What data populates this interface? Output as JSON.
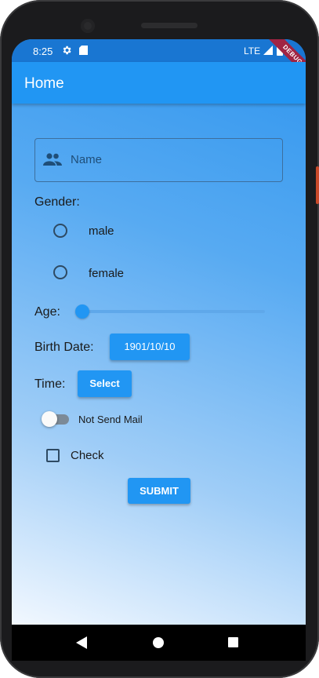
{
  "status_bar": {
    "time": "8:25",
    "network": "LTE",
    "icons": [
      "gear-icon",
      "sd-card-icon",
      "signal-icon",
      "battery-icon"
    ]
  },
  "debug_banner": "DEBUG",
  "app_bar": {
    "title": "Home"
  },
  "form": {
    "name_field": {
      "placeholder": "Name",
      "value": "",
      "icon": "people-icon"
    },
    "gender": {
      "label": "Gender:",
      "options": [
        {
          "label": "male",
          "selected": false
        },
        {
          "label": "female",
          "selected": false
        }
      ]
    },
    "age": {
      "label": "Age:",
      "value": 0
    },
    "birth_date": {
      "label": "Birth Date:",
      "button": "1901/10/10"
    },
    "time": {
      "label": "Time:",
      "button": "Select"
    },
    "mail_switch": {
      "label": "Not Send Mail",
      "on": false
    },
    "check": {
      "label": "Check",
      "checked": false
    },
    "submit": "SUBMIT"
  },
  "colors": {
    "primary": "#2196f3",
    "status_bar": "#1976d2",
    "debug_banner": "#a12444"
  },
  "nav_bar": {
    "buttons": [
      "back-icon",
      "home-icon",
      "recent-apps-icon"
    ]
  }
}
